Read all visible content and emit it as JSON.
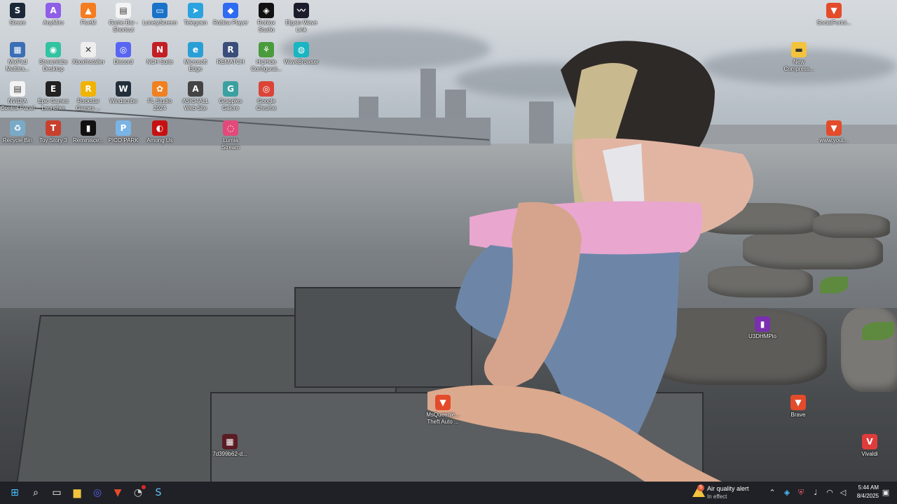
{
  "desktop": {
    "icons": [
      {
        "label": "Steam",
        "symbol": "S",
        "color": "#1b2838"
      },
      {
        "label": "AnyMiro",
        "symbol": "A",
        "color": "#8f5ee8"
      },
      {
        "label": "FiveM",
        "symbol": "▲",
        "color": "#f57c1f"
      },
      {
        "label": "Game Bar -\nShortcut",
        "symbol": "▤",
        "color": "#f3f3f3"
      },
      {
        "label": "LonelyScreen",
        "symbol": "▭",
        "color": "#1a73c9"
      },
      {
        "label": "Telegram",
        "symbol": "➤",
        "color": "#2aa3df"
      },
      {
        "label": "Roblox Player",
        "symbol": "◆",
        "color": "#2f6bf0"
      },
      {
        "label": "Roblox\nStudio",
        "symbol": "◈",
        "color": "#111111"
      },
      {
        "label": "Elgato Wave\nLink",
        "symbol": "〰",
        "color": "#1c1c2c"
      },
      {
        "label": "MixPad\nMultitra...",
        "symbol": "▦",
        "color": "#3a6fb5"
      },
      {
        "label": "Streamlabs\nDesktop",
        "symbol": "◉",
        "color": "#31c3a2"
      },
      {
        "label": "XboxInstaller",
        "symbol": "✕",
        "color": "#eeeeee"
      },
      {
        "label": "Discord",
        "symbol": "◎",
        "color": "#5865f2"
      },
      {
        "label": "NCH Suite",
        "symbol": "N",
        "color": "#c21f24"
      },
      {
        "label": "Microsoft\nEdge",
        "symbol": "e",
        "color": "#2a9fd6"
      },
      {
        "label": "REMATCH",
        "symbol": "R",
        "color": "#3b4d7a"
      },
      {
        "label": "HidHide\nConfigurat...",
        "symbol": "⚘",
        "color": "#4a9b3c"
      },
      {
        "label": "WaveBrowser",
        "symbol": "◍",
        "color": "#19b5c2"
      },
      {
        "label": "NVIDIA\nControl Panel",
        "symbol": "▤",
        "color": "#f3f3f3"
      },
      {
        "label": "Epic Games\nLauncher",
        "symbol": "E",
        "color": "#222222"
      },
      {
        "label": "Rockstar\nGames ...",
        "symbol": "R",
        "color": "#f0b400"
      },
      {
        "label": "Windscribe",
        "symbol": "W",
        "color": "#23303b"
      },
      {
        "label": "FL Studio\n2024",
        "symbol": "✿",
        "color": "#f08020"
      },
      {
        "label": "ASIO4ALL\nWeb Site",
        "symbol": "A",
        "color": "#444444"
      },
      {
        "label": "Grapples\nGalore",
        "symbol": "G",
        "color": "#3aa0a0"
      },
      {
        "label": "Google\nChrome",
        "symbol": "◎",
        "color": "#db4437"
      },
      {
        "label": "Recycle Bin",
        "symbol": "♻",
        "color": "#7aaac8"
      },
      {
        "label": "Toy Story 3",
        "symbol": "T",
        "color": "#c8402e"
      },
      {
        "label": "Reminisce...",
        "symbol": "▮",
        "color": "#111111"
      },
      {
        "label": "PICO PARK",
        "symbol": "P",
        "color": "#7ab4e6"
      },
      {
        "label": "Among Us",
        "symbol": "◐",
        "color": "#c51111"
      },
      {
        "label": "Lumia\nStream",
        "symbol": "◌",
        "color": "#e24a7a"
      },
      {
        "label": "SocialFortni...",
        "symbol": "▼",
        "color": "#e34b2a"
      },
      {
        "label": "New\nCompress...",
        "symbol": "▬",
        "color": "#f2c33c"
      },
      {
        "label": "www.yout...",
        "symbol": "▼",
        "color": "#e34b2a"
      },
      {
        "label": "U3DHMPlo",
        "symbol": "▮",
        "color": "#7a2fb0"
      },
      {
        "label": "MsQueenie...\nTheft Auto ...",
        "symbol": "▼",
        "color": "#e34b2a"
      },
      {
        "label": "Brave",
        "symbol": "▼",
        "color": "#e34b2a"
      },
      {
        "label": "7d399b62-d...",
        "symbol": "▦",
        "color": "#5a1c24"
      },
      {
        "label": "Vivaldi",
        "symbol": "V",
        "color": "#e03c3c"
      }
    ]
  },
  "taskbar": {
    "pinned": [
      {
        "name": "start-button",
        "symbol": "⊞",
        "color": "#4cc2ff"
      },
      {
        "name": "search-button",
        "symbol": "⌕",
        "color": "#ffffff"
      },
      {
        "name": "task-view-button",
        "symbol": "▭",
        "color": "#ffffff"
      },
      {
        "name": "file-explorer-button",
        "symbol": "▆",
        "color": "#f2c33c"
      },
      {
        "name": "discord-taskbar-button",
        "symbol": "◎",
        "color": "#5865f2"
      },
      {
        "name": "brave-taskbar-button",
        "symbol": "▼",
        "color": "#e34b2a"
      },
      {
        "name": "app-taskbar-button",
        "symbol": "◔",
        "color": "#cfcfcf"
      },
      {
        "name": "steam-taskbar-button",
        "symbol": "S",
        "color": "#66c0f4"
      }
    ],
    "weather": {
      "badge": "5",
      "title": "Air quality alert",
      "subtitle": "In effect"
    },
    "tray": [
      "chevron-up-icon",
      "network-app-icon",
      "shield-icon",
      "microphone-icon",
      "wifi-icon",
      "display-icon",
      "volume-icon",
      "battery-icon"
    ],
    "clock": {
      "time": "5:44 AM",
      "date": "8/4/2025"
    }
  }
}
